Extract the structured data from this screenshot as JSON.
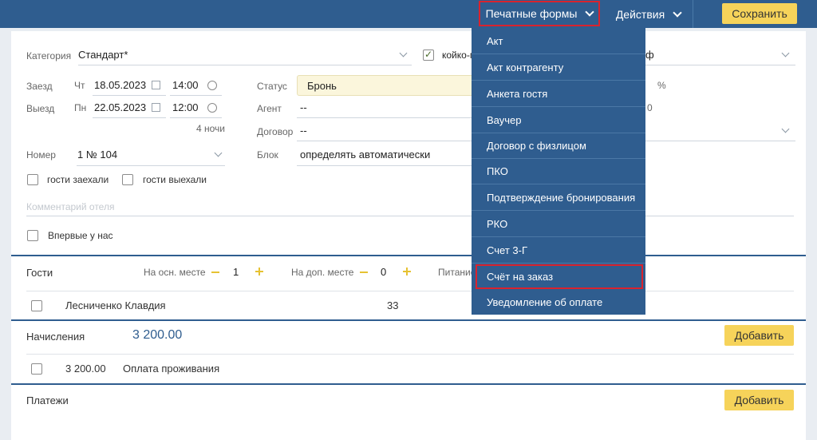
{
  "toolbar": {
    "print_forms": "Печатные формы",
    "actions": "Действия",
    "save": "Сохранить"
  },
  "form": {
    "category_label": "Категория",
    "category_value": "Стандарт*",
    "bed_checkbox_label": "койко-м",
    "rate_value_fragment": "ф",
    "arrival_label": "Заезд",
    "arrival_dow": "Чт",
    "arrival_date": "18.05.2023",
    "arrival_time": "14:00",
    "departure_label": "Выезд",
    "departure_dow": "Пн",
    "departure_date": "22.05.2023",
    "departure_time": "12:00",
    "nights": "4 ночи",
    "status_label": "Статус",
    "status_value": "Бронь",
    "percent": "%",
    "agent_label": "Агент",
    "agent_value": "--",
    "agent_tail": "0",
    "contract_label": "Договор",
    "contract_value": "--",
    "room_label": "Номер",
    "room_value": "1 № 104",
    "block_label": "Блок",
    "block_value": "определять автоматически",
    "guests_checked_in": "гости заехали",
    "guests_checked_out": "гости выехали",
    "hotel_comment_placeholder": "Комментарий отеля",
    "first_time": "Впервые у нас"
  },
  "guests": {
    "title": "Гости",
    "main_place_label": "На осн. месте",
    "main_place_value": "1",
    "extra_place_label": "На доп. месте",
    "extra_place_value": "0",
    "meals_label": "Питание",
    "rows": [
      {
        "name": "Лесниченко Клавдия",
        "age": "33"
      }
    ]
  },
  "charges": {
    "title": "Начисления",
    "total": "3 200.00",
    "add": "Добавить",
    "rows": [
      {
        "amount": "3 200.00",
        "description": "Оплата проживания"
      }
    ]
  },
  "payments": {
    "title": "Платежи",
    "add": "Добавить"
  },
  "print_menu": {
    "items": [
      "Акт",
      "Акт контрагенту",
      "Анкета гостя",
      "Ваучер",
      "Договор с физлицом",
      "ПКО",
      "Подтверждение бронирования",
      "РКО",
      "Счет 3-Г",
      "Счёт на заказ",
      "Уведомление об оплате"
    ],
    "highlighted": "Счёт на заказ"
  },
  "colors": {
    "header": "#2f5d8f",
    "accent_button": "#f6d35a",
    "highlight_outline": "#d9232e",
    "status_bg": "#fbf6dc"
  }
}
